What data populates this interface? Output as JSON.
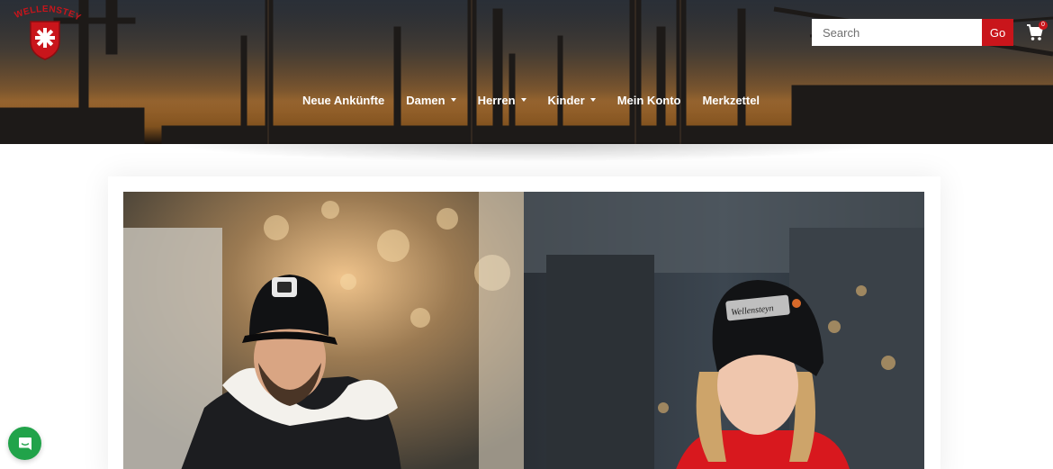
{
  "brand": {
    "logo_text": "WELLENSTEYN",
    "accent_color": "#c9151b"
  },
  "search": {
    "placeholder": "Search",
    "button_label": "Go"
  },
  "cart": {
    "icon": "shopping-cart-icon",
    "count": "0"
  },
  "nav": {
    "items": [
      {
        "label": "Neue Ankünfte",
        "dropdown": false
      },
      {
        "label": "Damen",
        "dropdown": true
      },
      {
        "label": "Herren",
        "dropdown": true
      },
      {
        "label": "Kinder",
        "dropdown": true
      },
      {
        "label": "Mein Konto",
        "dropdown": false
      },
      {
        "label": "Merkzettel",
        "dropdown": false
      }
    ]
  },
  "hero": {
    "left_image": "man-in-black-cap-and-fur-collar-jacket",
    "right_image": "woman-in-black-beanie-and-red-jacket",
    "beanie_text": "Wellensteyn"
  },
  "chat": {
    "icon": "chat-bubble-icon",
    "color": "#21a34a"
  }
}
